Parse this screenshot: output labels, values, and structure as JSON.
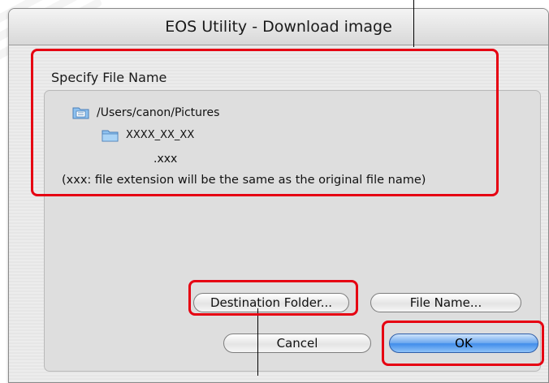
{
  "window": {
    "title": "EOS Utility - Download image"
  },
  "file_name_group": {
    "label": "Specify File Name",
    "path": "/Users/canon/Pictures",
    "folder": "XXXX_XX_XX",
    "extension": ".xxx",
    "note": "(xxx: file extension will be the same as the original file name)"
  },
  "buttons": {
    "destination_folder": "Destination Folder...",
    "file_name": "File Name...",
    "cancel": "Cancel",
    "ok": "OK"
  },
  "colors": {
    "highlight": "#e60012",
    "default_button": "#3f8bea"
  },
  "icons": {
    "path_folder": "folder-icon",
    "subfolder": "folder-icon"
  }
}
